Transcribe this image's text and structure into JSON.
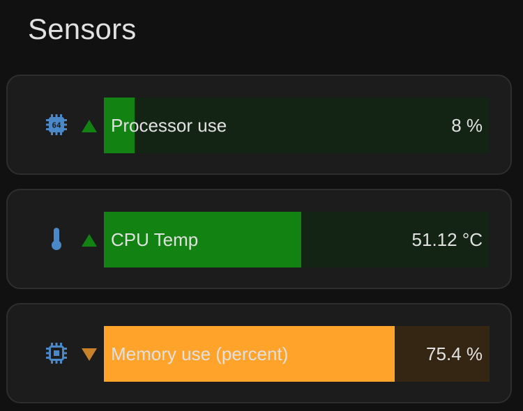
{
  "title": "Sensors",
  "colors": {
    "ok_fill": "#128212",
    "ok_track": "#142414",
    "warn_fill": "#ffa32a",
    "warn_track": "#342612",
    "ok_trend": "#128212",
    "warn_trend": "#c9822a",
    "icon": "#4a88c8"
  },
  "sensors": [
    {
      "name": "Processor use",
      "value": "8 %",
      "level": 0.08,
      "icon": "cpu-64-bit-icon",
      "trend": "up",
      "status": "ok"
    },
    {
      "name": "CPU Temp",
      "value": "51.12 °C",
      "level": 0.5112,
      "icon": "thermometer-icon",
      "trend": "up",
      "status": "ok"
    },
    {
      "name": "Memory use (percent)",
      "value": "75.4 %",
      "level": 0.754,
      "icon": "memory-chip-icon",
      "trend": "down",
      "status": "warning"
    }
  ]
}
